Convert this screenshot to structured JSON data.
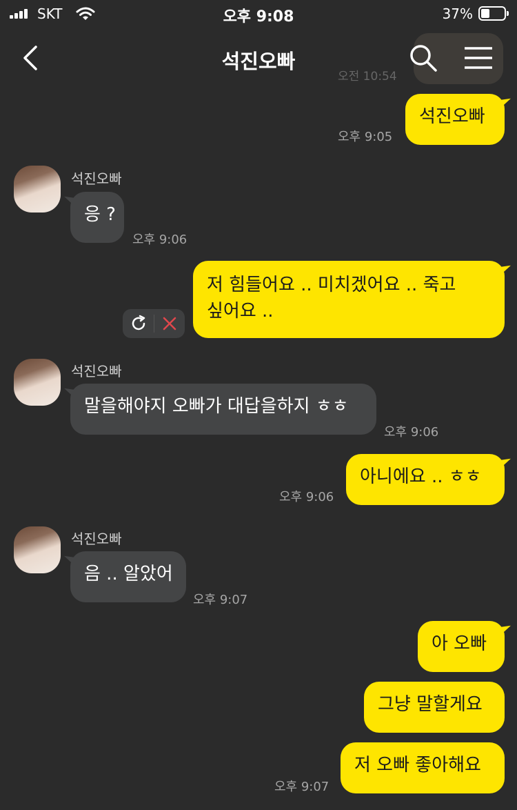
{
  "status_bar": {
    "carrier": "SKT",
    "time": "오후 9:08",
    "battery": "37%",
    "battery_level": 0.37
  },
  "header": {
    "title": "석진오빠",
    "ghost_time": "오전 10:54"
  },
  "contact": {
    "name": "석진오빠"
  },
  "messages": [
    {
      "sender": "me",
      "text": "석진오빠",
      "time": "오후 9:05"
    },
    {
      "sender": "contact",
      "text": "응 ?",
      "time": "오후 9:06"
    },
    {
      "sender": "me",
      "line1": "저 힘들어요 .. 미치겠어요 .. 죽고",
      "line2": "싶어요 ..",
      "status": "failed"
    },
    {
      "sender": "contact",
      "text": "말을해야지 오빠가 대답을하지 ㅎㅎ",
      "time": "오후 9:06"
    },
    {
      "sender": "me",
      "text": "아니에요 .. ㅎㅎ",
      "time": "오후 9:06"
    },
    {
      "sender": "contact",
      "text": "음 .. 알았어",
      "time": "오후 9:07"
    },
    {
      "sender": "me",
      "text": "아 오빠"
    },
    {
      "sender": "me",
      "text": "그냥 말할게요"
    },
    {
      "sender": "me",
      "text": "저 오빠 좋아해요",
      "time": "오후 9:07"
    }
  ],
  "colors": {
    "background": "#2b2b2b",
    "my_bubble": "#fee500",
    "their_bubble": "#444546",
    "retry_icon": "#ffffff",
    "delete_icon": "#e0474c"
  }
}
